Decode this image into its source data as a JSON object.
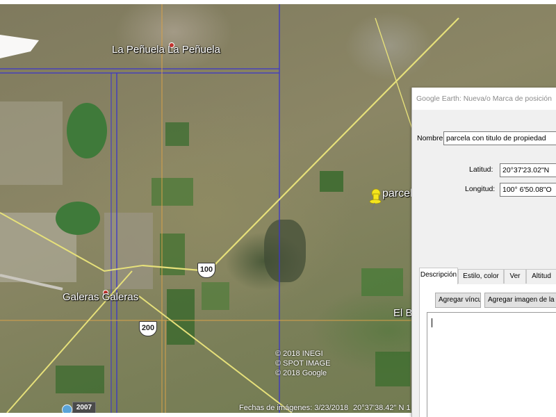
{
  "map": {
    "labels": {
      "town_north": "La Peñuela  La Peñuela",
      "town_south": "Galeras  Galeras",
      "town_east": "El B"
    },
    "road_shields": [
      "100",
      "200"
    ],
    "copyright": [
      "© 2018 INEGI",
      "© SPOT IMAGE",
      "© 2018 Google"
    ],
    "status": {
      "history_year": "2007",
      "imagery_date": "Fechas de imágenes: 3/23/2018",
      "coordinates": "20°37'38.42\" N   1"
    },
    "placemark_label": "parcela",
    "colors": {
      "grid_blue": "#3b35c9",
      "grid_orange": "#d9a24a",
      "road_yellow": "#e6e07a",
      "pin_yellow": "#f5e51c"
    }
  },
  "dialog": {
    "title": "Google Earth: Nueva/o Marca de posición",
    "name_label": "Nombre:",
    "name_value": "parcela con titulo de propiedad",
    "lat_label": "Latitud:",
    "lat_value": "20°37'23.02\"N",
    "lon_label": "Longitud:",
    "lon_value": "100° 6'50.08\"O",
    "tabs": [
      {
        "label": "Descripción",
        "active": true
      },
      {
        "label": "Estilo, color",
        "active": false
      },
      {
        "label": "Ver",
        "active": false
      },
      {
        "label": "Altitud",
        "active": false
      }
    ],
    "buttons": {
      "add_link": "Agregar vínculo",
      "add_web_image": "Agregar imagen de la Web"
    },
    "description_value": ""
  }
}
